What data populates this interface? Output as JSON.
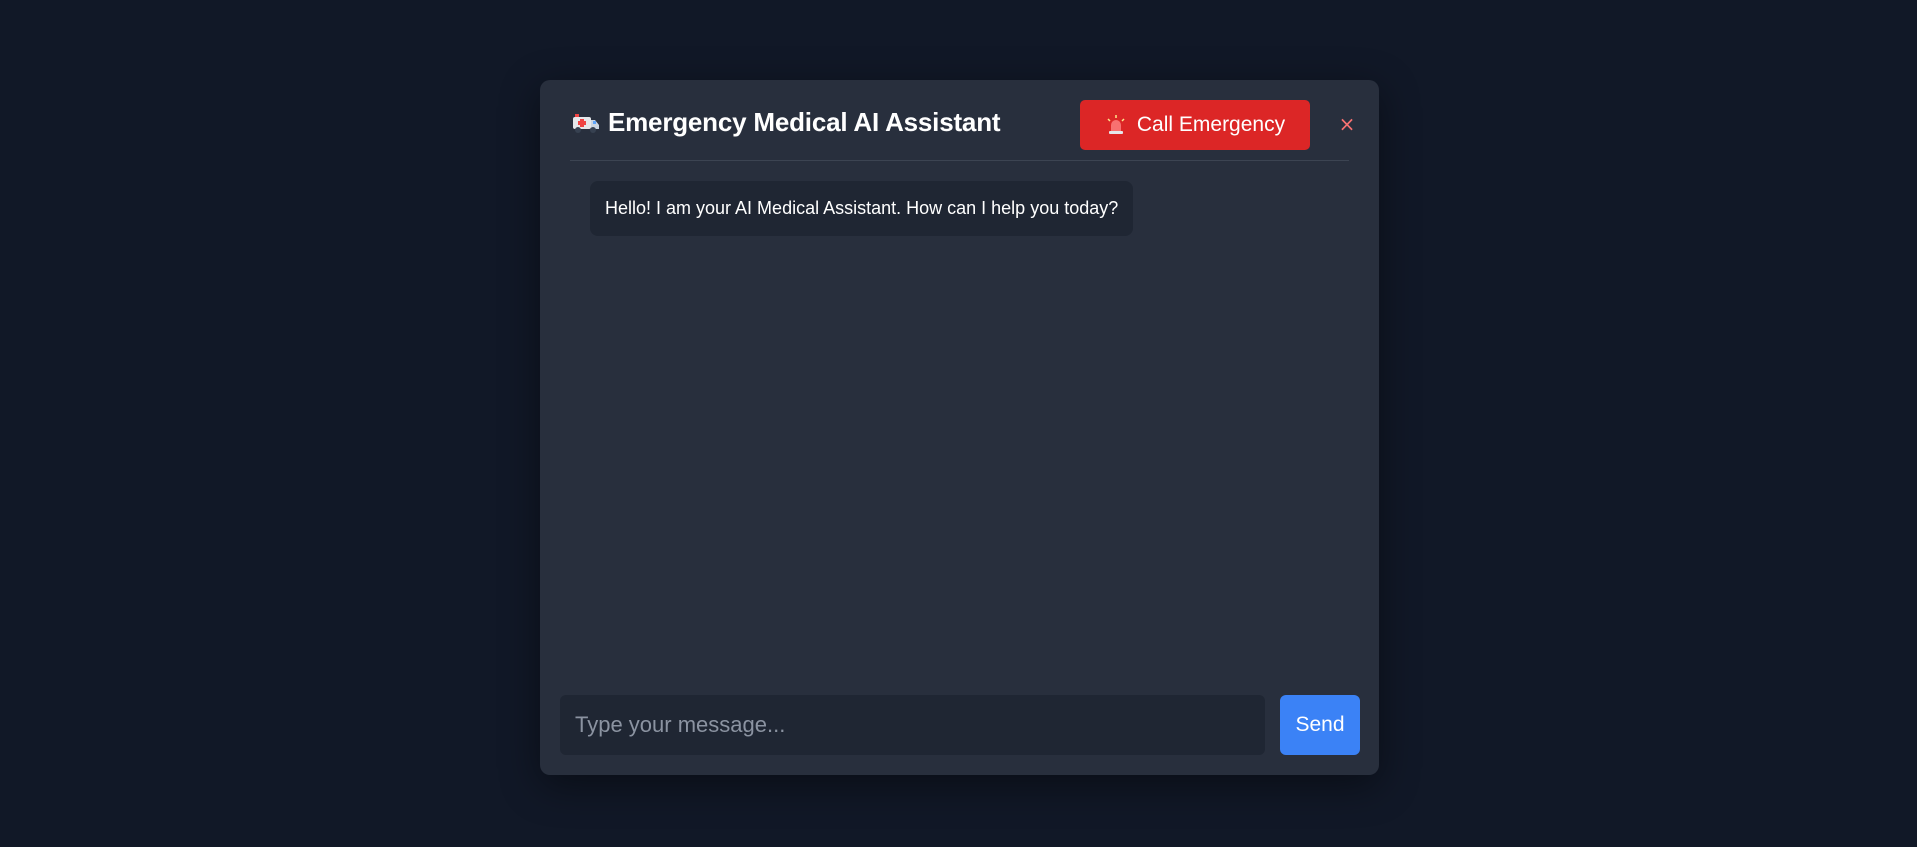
{
  "header": {
    "title_icon": "ambulance-icon",
    "title": "Emergency Medical AI Assistant",
    "emergency_button": {
      "icon": "siren-icon",
      "label": "Call Emergency",
      "color": "#dc2626"
    },
    "close_label": "×"
  },
  "messages": [
    {
      "sender": "assistant",
      "text": "Hello! I am your AI Medical Assistant. How can I help you today?"
    }
  ],
  "composer": {
    "placeholder": "Type your message...",
    "value": "",
    "send_label": "Send",
    "send_color": "#3b82f6"
  }
}
